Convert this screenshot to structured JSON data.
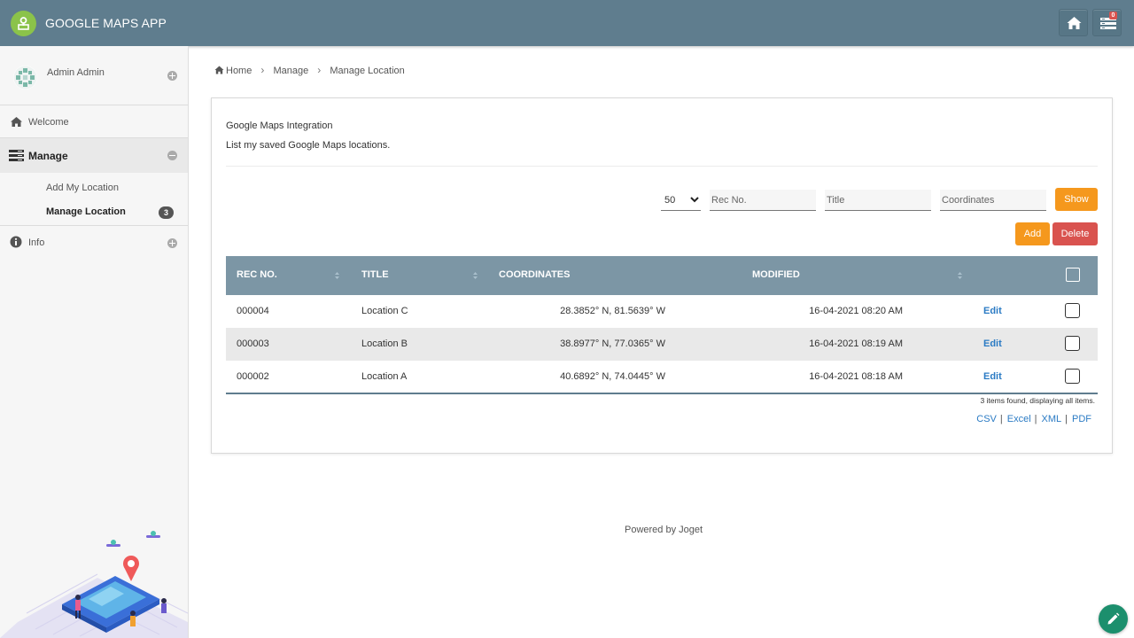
{
  "header": {
    "app_title": "GOOGLE MAPS APP",
    "home_icon": "home-icon",
    "inbox_icon": "inbox-icon",
    "inbox_badge": "0",
    "bar_color": "#5f7d8e"
  },
  "sidebar": {
    "user_name": "Admin Admin",
    "items": [
      {
        "label": "Welcome",
        "icon": "home-icon"
      },
      {
        "label": "Manage",
        "icon": "menu-stack-icon"
      },
      {
        "label": "Info",
        "icon": "info-icon"
      }
    ],
    "sub_items": [
      {
        "label": "Add My Location"
      },
      {
        "label": "Manage Location",
        "count": "3"
      }
    ]
  },
  "breadcrumb": {
    "items": [
      "Home",
      "Manage",
      "Manage Location"
    ]
  },
  "panel": {
    "title": "Google Maps Integration",
    "description": "List my saved Google Maps locations.",
    "filters": {
      "page_size": "50",
      "rec_no_placeholder": "Rec No.",
      "title_placeholder": "Title",
      "coordinates_placeholder": "Coordinates",
      "show_label": "Show"
    },
    "actions": {
      "add_label": "Add",
      "delete_label": "Delete"
    },
    "table": {
      "columns": [
        "REC NO.",
        "TITLE",
        "COORDINATES",
        "MODIFIED"
      ],
      "rows": [
        {
          "rec_no": "000004",
          "title": "Location C",
          "coordinates": "28.3852° N, 81.5639° W",
          "modified": "16-04-2021 08:20 AM",
          "action": "Edit"
        },
        {
          "rec_no": "000003",
          "title": "Location B",
          "coordinates": "38.8977° N, 77.0365° W",
          "modified": "16-04-2021 08:19 AM",
          "action": "Edit"
        },
        {
          "rec_no": "000002",
          "title": "Location A",
          "coordinates": "40.6892° N, 74.0445° W",
          "modified": "16-04-2021 08:18 AM",
          "action": "Edit"
        }
      ],
      "found_text": "3 items found, displaying all items.",
      "exports": [
        "CSV",
        "Excel",
        "XML",
        "PDF"
      ]
    }
  },
  "footer": {
    "text": "Powered by Joget"
  },
  "colors": {
    "accent_orange": "#f5981d",
    "danger_red": "#d9534f",
    "link_blue": "#2b7bc4",
    "table_header": "#7c96a5",
    "fab_green": "#1c8f6d"
  }
}
